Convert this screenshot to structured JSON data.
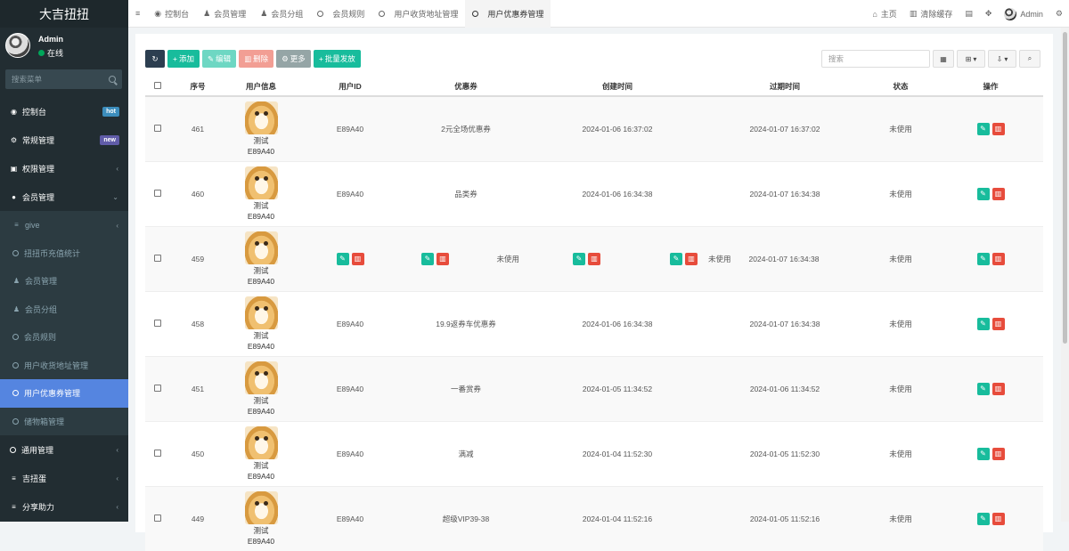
{
  "app_title": "大吉扭扭",
  "user": {
    "name": "Admin",
    "status": "在线"
  },
  "sidebar_search_placeholder": "搜索菜单",
  "menu": [
    {
      "label": "控制台",
      "badge": "hot"
    },
    {
      "label": "常规管理",
      "badge": "new"
    },
    {
      "label": "权限管理"
    },
    {
      "label": "会员管理"
    }
  ],
  "submenu": [
    "give",
    "扭扭币充值统计",
    "会员管理",
    "会员分组",
    "会员规则",
    "用户收货地址管理",
    "用户优惠券管理",
    "储物箱管理"
  ],
  "menu_bottom": [
    "通用管理",
    "吉扭蛋",
    "分享助力"
  ],
  "tabs": [
    "控制台",
    "会员管理",
    "会员分组",
    "会员规则",
    "用户收货地址管理",
    "用户优惠券管理"
  ],
  "topbar_right": {
    "home": "主页",
    "clear_cache": "清除缓存",
    "admin": "Admin"
  },
  "toolbar": {
    "add": "添加",
    "edit": "编辑",
    "delete": "删除",
    "more": "更多",
    "batch": "批量发放"
  },
  "table_search_placeholder": "搜索",
  "columns": [
    "序号",
    "用户信息",
    "用户ID",
    "优惠券",
    "创建时间",
    "过期时间",
    "状态",
    "操作"
  ],
  "rows": [
    {
      "id": "461",
      "nick": "测试",
      "code": "E89A40",
      "uid": "E89A40",
      "coupon": "2元全场优惠券",
      "created": "2024-01-06 16:37:02",
      "expire": "2024-01-07 16:37:02",
      "status": "未使用"
    },
    {
      "id": "460",
      "nick": "测试",
      "code": "E89A40",
      "uid": "E89A40",
      "coupon": "品类券",
      "created": "2024-01-06 16:34:38",
      "expire": "2024-01-07 16:34:38",
      "status": "未使用"
    },
    {
      "id": "459",
      "nick": "测试",
      "code": "E89A40",
      "uid": "",
      "coupon": "未使用",
      "created": "",
      "expire": "2024-01-07 16:34:38",
      "status": "未使用",
      "extra_status": "未使用"
    },
    {
      "id": "458",
      "nick": "测试",
      "code": "E89A40",
      "uid": "E89A40",
      "coupon": "19.9返券车优惠券",
      "created": "2024-01-06 16:34:38",
      "expire": "2024-01-07 16:34:38",
      "status": "未使用"
    },
    {
      "id": "451",
      "nick": "测试",
      "code": "E89A40",
      "uid": "E89A40",
      "coupon": "一番赏券",
      "created": "2024-01-05 11:34:52",
      "expire": "2024-01-06 11:34:52",
      "status": "未使用"
    },
    {
      "id": "450",
      "nick": "测试",
      "code": "E89A40",
      "uid": "E89A40",
      "coupon": "满减",
      "created": "2024-01-04 11:52:30",
      "expire": "2024-01-05 11:52:30",
      "status": "未使用"
    },
    {
      "id": "449",
      "nick": "测试",
      "code": "E89A40",
      "uid": "E89A40",
      "coupon": "超级VIP39-38",
      "created": "2024-01-04 11:52:16",
      "expire": "2024-01-05 11:52:16",
      "status": "未使用"
    }
  ]
}
